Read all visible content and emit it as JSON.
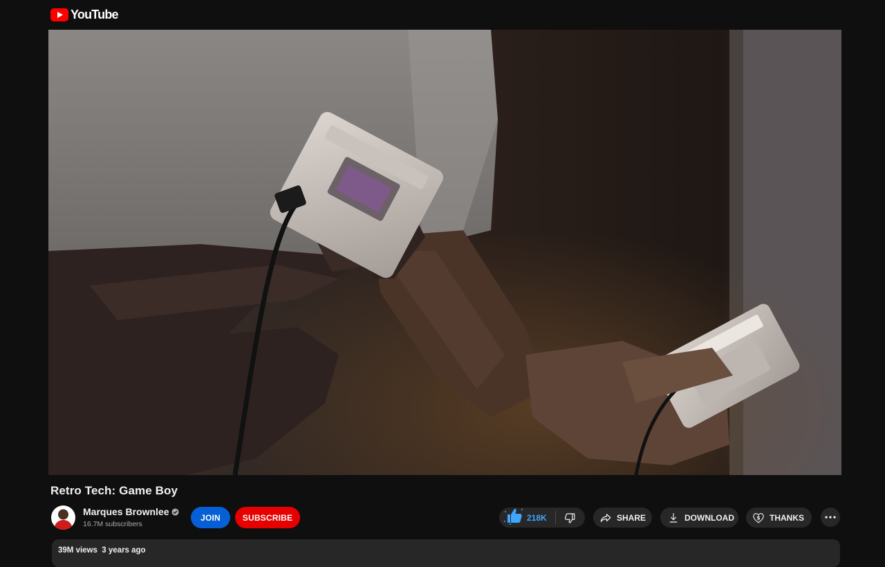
{
  "app": {
    "logo_text": "YouTube"
  },
  "video": {
    "title": "Retro Tech: Game Boy"
  },
  "channel": {
    "name": "Marques Brownlee",
    "subscribers": "16.7M subscribers",
    "verified": true
  },
  "buttons": {
    "join": "JOIN",
    "subscribe": "SUBSCRIBE",
    "like_count": "218K",
    "share": "SHARE",
    "download": "DOWNLOAD",
    "thanks": "THANKS"
  },
  "description": {
    "views": "39M views",
    "age": "3 years ago"
  },
  "icons": {
    "logo": "youtube-logo-icon",
    "verified": "verified-check-icon",
    "like": "thumbs-up-icon",
    "dislike": "thumbs-down-icon",
    "share": "share-arrow-icon",
    "download": "download-icon",
    "thanks": "dollar-heart-icon",
    "more": "more-horizontal-icon"
  },
  "colors": {
    "background": "#0f0f0f",
    "join": "#065fd4",
    "subscribe": "#e60000",
    "like_accent": "#3ea6ff",
    "pill": "#272727"
  }
}
